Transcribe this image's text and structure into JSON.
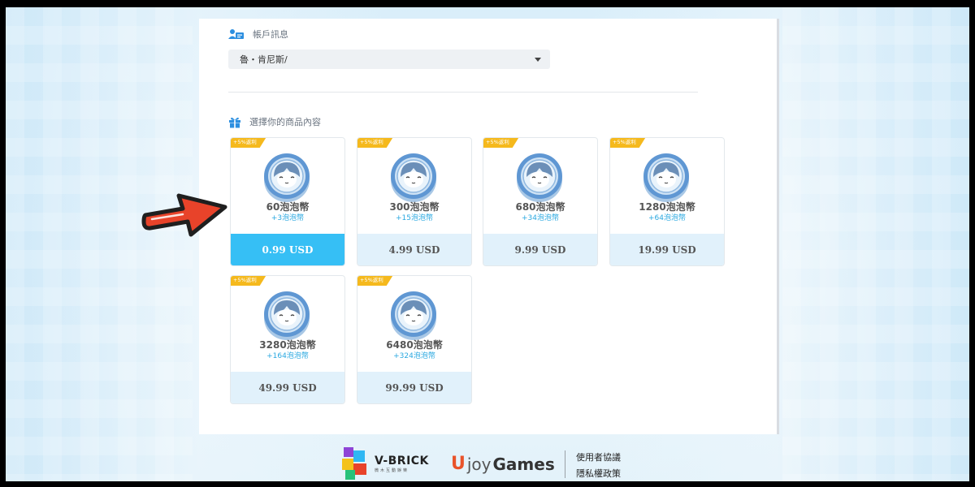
{
  "account": {
    "section_title": "帳戶訊息",
    "selected_value": "魯・肯尼斯/"
  },
  "products": {
    "section_title": "選擇你的商品內容",
    "badge": "+5%返利",
    "items": [
      {
        "name": "60泡泡幣",
        "bonus": "+3泡泡幣",
        "price": "0.99 USD",
        "selected": true
      },
      {
        "name": "300泡泡幣",
        "bonus": "+15泡泡幣",
        "price": "4.99 USD",
        "selected": false
      },
      {
        "name": "680泡泡幣",
        "bonus": "+34泡泡幣",
        "price": "9.99 USD",
        "selected": false
      },
      {
        "name": "1280泡泡幣",
        "bonus": "+64泡泡幣",
        "price": "19.99 USD",
        "selected": false
      },
      {
        "name": "3280泡泡幣",
        "bonus": "+164泡泡幣",
        "price": "49.99 USD",
        "selected": false
      },
      {
        "name": "6480泡泡幣",
        "bonus": "+324泡泡幣",
        "price": "99.99 USD",
        "selected": false
      }
    ]
  },
  "footer": {
    "vbrick_name": "V-BRICK",
    "vbrick_sub": "微木互動娛樂",
    "ujoy_u": "U",
    "ujoy_joy": "joy",
    "ujoy_games": "Games",
    "terms_link": "使用者協議",
    "privacy_link": "隱私權政策"
  },
  "colors": {
    "selected_price": "#36bff5",
    "price_bg": "#e1f1fb",
    "badge": "#f5b91d",
    "bonus_text": "#2aa8e0",
    "arrow": "#e8432a"
  },
  "icons": [
    "account-icon",
    "gift-icon",
    "chevron-down-icon",
    "coin-icon",
    "pointer-arrow-icon",
    "vbrick-logo-icon"
  ]
}
